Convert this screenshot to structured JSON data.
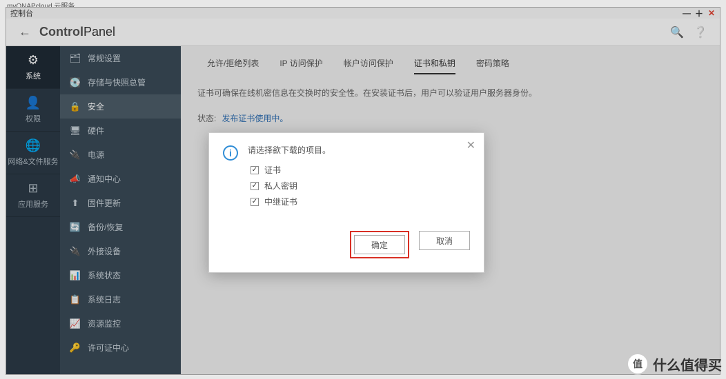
{
  "top_strip": "myQNAPcloud 云服务",
  "window": {
    "title": "控制台"
  },
  "header": {
    "title_bold": "Control",
    "title_light": "Panel"
  },
  "left_rail": [
    {
      "icon": "⚙",
      "label": "系统",
      "active": true
    },
    {
      "icon": "👤",
      "label": "权限"
    },
    {
      "icon": "🌐",
      "label": "网络&文件服务"
    },
    {
      "icon": "⊞",
      "label": "应用服务"
    }
  ],
  "sub_menu": [
    {
      "icon": "🗂",
      "label": "常规设置"
    },
    {
      "icon": "💽",
      "label": "存储与快照总管"
    },
    {
      "icon": "🔒",
      "label": "安全",
      "active": true
    },
    {
      "icon": "🖥",
      "label": "硬件"
    },
    {
      "icon": "🔌",
      "label": "电源"
    },
    {
      "icon": "📣",
      "label": "通知中心"
    },
    {
      "icon": "⬆",
      "label": "固件更新"
    },
    {
      "icon": "🔄",
      "label": "备份/恢复"
    },
    {
      "icon": "🔌",
      "label": "外接设备"
    },
    {
      "icon": "📊",
      "label": "系统状态"
    },
    {
      "icon": "📋",
      "label": "系统日志"
    },
    {
      "icon": "📈",
      "label": "资源监控"
    },
    {
      "icon": "🔑",
      "label": "许可证中心"
    }
  ],
  "tabs": [
    {
      "label": "允许/拒绝列表"
    },
    {
      "label": "IP 访问保护"
    },
    {
      "label": "帐户访问保护"
    },
    {
      "label": "证书和私钥",
      "active": true
    },
    {
      "label": "密码策略"
    }
  ],
  "main": {
    "desc": "证书可确保在线机密信息在交换时的安全性。在安装证书后，用户可以验证用户服务器身份。",
    "status_label": "状态:",
    "status_value": "发布证书使用中。"
  },
  "modal": {
    "prompt": "请选择欲下载的项目。",
    "options": [
      {
        "label": "证书",
        "checked": true
      },
      {
        "label": "私人密钥",
        "checked": true
      },
      {
        "label": "中继证书",
        "checked": true
      }
    ],
    "ok": "确定",
    "cancel": "取消"
  },
  "watermark": "什么值得买"
}
